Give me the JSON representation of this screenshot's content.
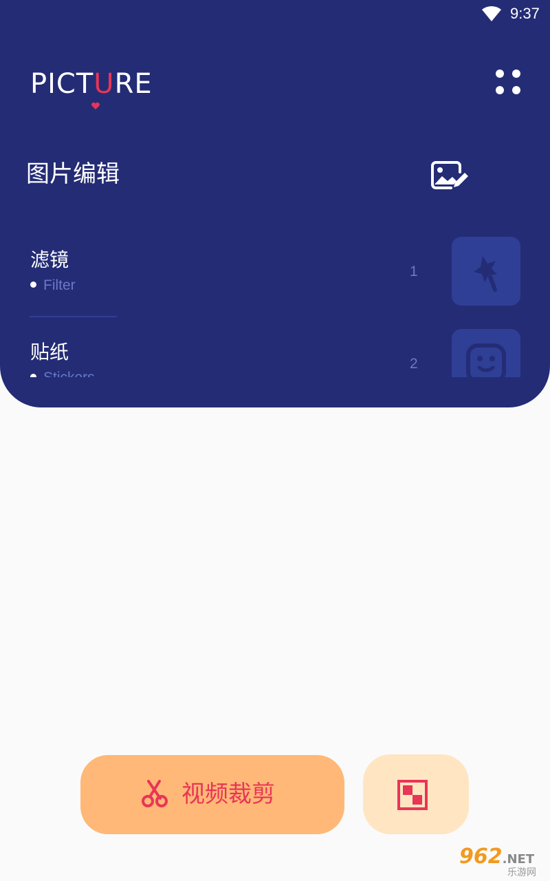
{
  "status_bar": {
    "time": "9:37",
    "wifi_icon": "wifi-icon"
  },
  "header": {
    "logo_text_before": "PICT",
    "logo_text_accent": "U",
    "logo_text_after": "RE",
    "apps_icon": "grid-dots-icon"
  },
  "section": {
    "title": "图片编辑",
    "icon": "image-edit-icon"
  },
  "tools": [
    {
      "name": "滤镜",
      "subtitle": "Filter",
      "index": "1",
      "icon": "magic-wand-star-icon"
    },
    {
      "name": "贴纸",
      "subtitle": "Stickers",
      "index": "2",
      "icon": "sticker-face-icon"
    }
  ],
  "actions": {
    "video_crop_label": "视频裁剪",
    "video_crop_icon": "scissors-icon",
    "mosaic_icon": "mosaic-icon"
  },
  "watermark": {
    "logo": "962",
    "net": ".NET",
    "sub": "乐游网"
  },
  "colors": {
    "header_bg": "#242c75",
    "accent_red": "#e83556",
    "orange_button": "#ffb877",
    "light_orange_button": "#ffe5c2",
    "thumb_bg": "#2f3f96",
    "subtitle_text": "#6a79c8",
    "page_bg": "#fafafa"
  }
}
